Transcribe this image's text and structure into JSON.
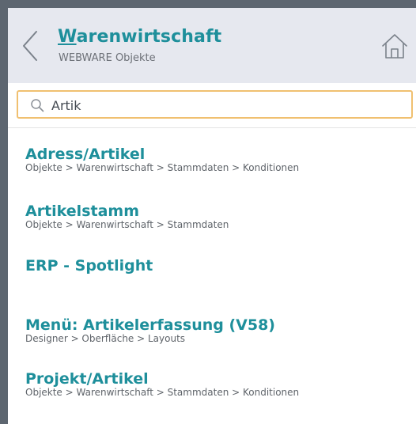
{
  "header": {
    "title_underlined_letter": "W",
    "title_rest": "arenwirtschaft",
    "subtitle": "WEBWARE Objekte",
    "back_icon": "chevron-left-icon",
    "home_icon": "home-icon"
  },
  "search": {
    "value": "Artik",
    "placeholder": "",
    "icon": "search-icon"
  },
  "results": [
    {
      "title": "Adress/Artikel",
      "path": "Objekte > Warenwirtschaft > Stammdaten > Konditionen"
    },
    {
      "title": "Artikelstamm",
      "path": "Objekte > Warenwirtschaft > Stammdaten"
    },
    {
      "title": "ERP - Spotlight",
      "path": ""
    },
    {
      "title": "Menü: Artikelerfassung (V58)",
      "path": "Designer > Oberfläche > Layouts"
    },
    {
      "title": "Projekt/Artikel",
      "path": "Objekte > Warenwirtschaft > Stammdaten > Konditionen"
    }
  ],
  "colors": {
    "accent": "#1e8f9b",
    "header_bg": "#e6e8ef",
    "search_border": "#f0c070"
  }
}
